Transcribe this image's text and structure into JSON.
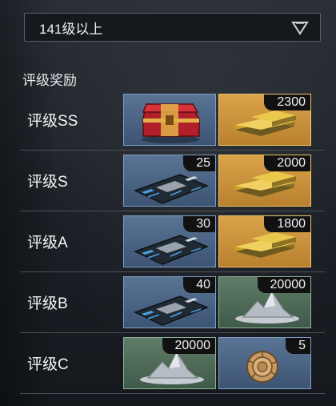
{
  "level_filter": {
    "selected": "141级以上"
  },
  "section_title": "评级奖励",
  "rows": [
    {
      "rank": "评级SS",
      "rewards": [
        {
          "item": "red-chest",
          "count": ""
        },
        {
          "item": "gold-bars",
          "count": "2300"
        }
      ]
    },
    {
      "rank": "评级S",
      "rewards": [
        {
          "item": "circuit-board",
          "count": "25"
        },
        {
          "item": "gold-bars",
          "count": "2000"
        }
      ]
    },
    {
      "rank": "评级A",
      "rewards": [
        {
          "item": "circuit-board",
          "count": "30"
        },
        {
          "item": "gold-bars",
          "count": "1800"
        }
      ]
    },
    {
      "rank": "评级B",
      "rewards": [
        {
          "item": "circuit-board",
          "count": "40"
        },
        {
          "item": "silver-ore",
          "count": "20000"
        }
      ]
    },
    {
      "rank": "评级C",
      "rewards": [
        {
          "item": "silver-ore",
          "count": "20000"
        },
        {
          "item": "ammonite-fossil",
          "count": "5"
        }
      ]
    }
  ],
  "colors": {
    "slot_blue": "#4b6588",
    "slot_gold": "#c8913a",
    "slot_green": "#4d6a57"
  }
}
